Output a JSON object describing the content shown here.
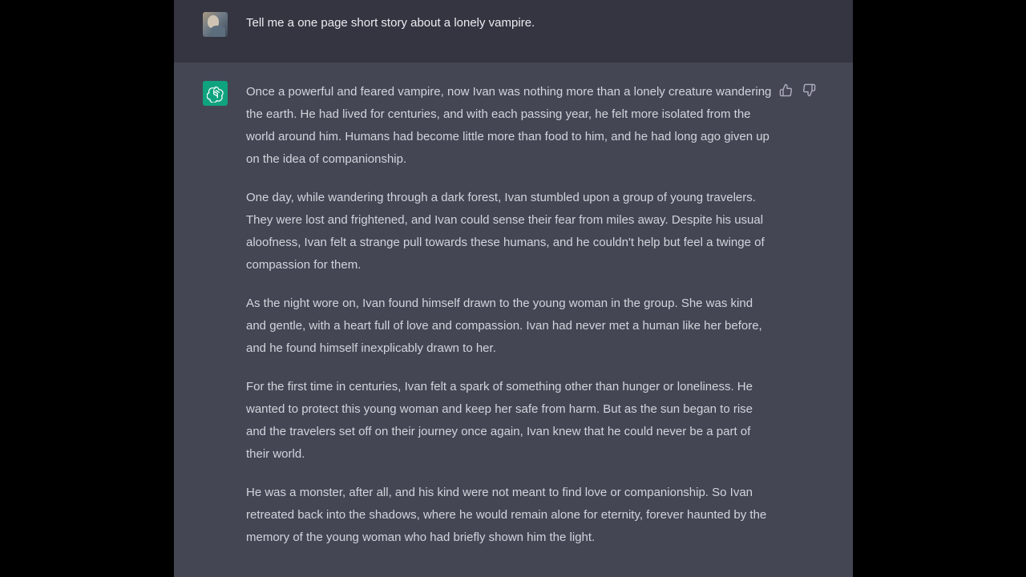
{
  "user_message": {
    "text": "Tell me a one page short story about a lonely vampire."
  },
  "assistant_message": {
    "avatar_icon": "openai-logo-icon",
    "accent_color": "#10a37f",
    "paragraphs": [
      "Once a powerful and feared vampire, now Ivan was nothing more than a lonely creature wandering the earth. He had lived for centuries, and with each passing year, he felt more isolated from the world around him. Humans had become little more than food to him, and he had long ago given up on the idea of companionship.",
      "One day, while wandering through a dark forest, Ivan stumbled upon a group of young travelers. They were lost and frightened, and Ivan could sense their fear from miles away. Despite his usual aloofness, Ivan felt a strange pull towards these humans, and he couldn't help but feel a twinge of compassion for them.",
      "As the night wore on, Ivan found himself drawn to the young woman in the group. She was kind and gentle, with a heart full of love and compassion. Ivan had never met a human like her before, and he found himself inexplicably drawn to her.",
      "For the first time in centuries, Ivan felt a spark of something other than hunger or loneliness. He wanted to protect this young woman and keep her safe from harm. But as the sun began to rise and the travelers set off on their journey once again, Ivan knew that he could never be a part of their world.",
      "He was a monster, after all, and his kind were not meant to find love or companionship. So Ivan retreated back into the shadows, where he would remain alone for eternity, forever haunted by the memory of the young woman who had briefly shown him the light."
    ],
    "feedback_icons": [
      "thumbs-up-icon",
      "thumbs-down-icon"
    ]
  },
  "colors": {
    "page_background": "#000000",
    "user_row_background": "#343541",
    "assistant_row_background": "#444654",
    "text_primary": "#ececf1",
    "text_secondary": "#d1d5db"
  }
}
